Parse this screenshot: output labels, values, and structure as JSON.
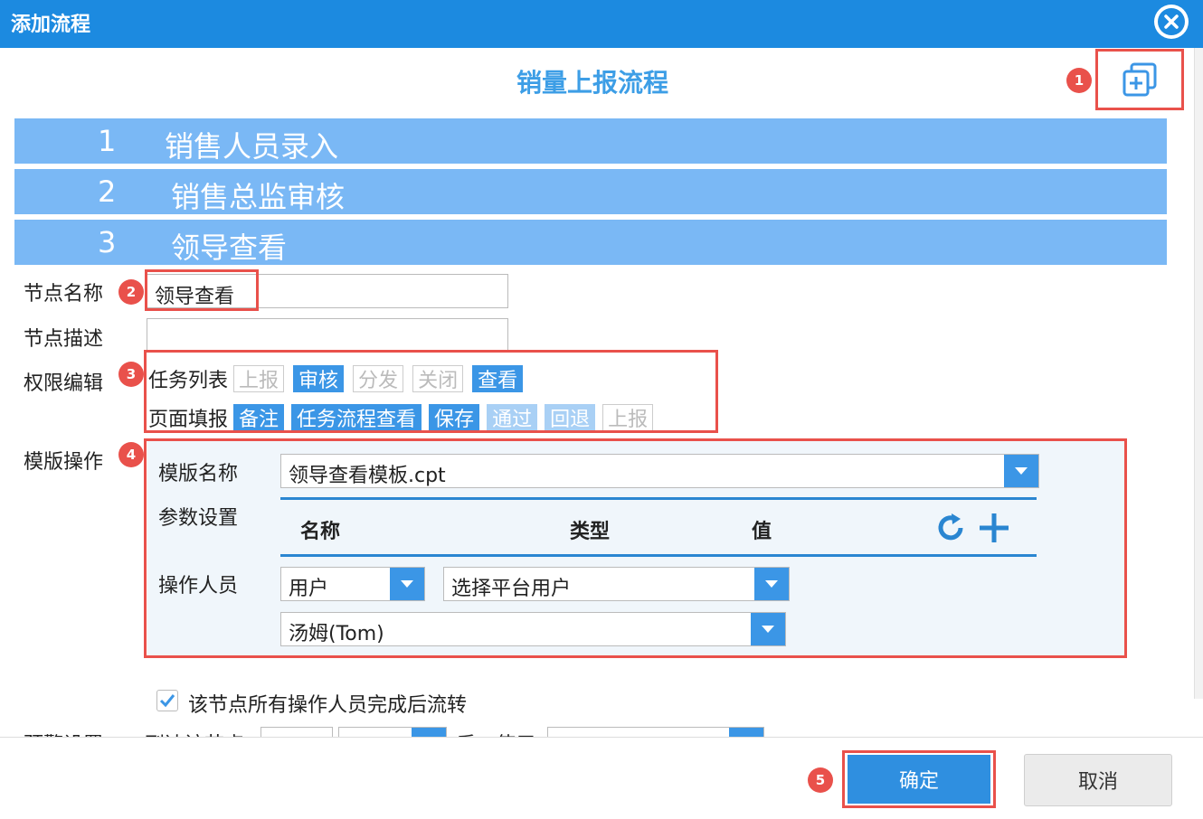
{
  "dialog": {
    "title": "添加流程"
  },
  "flow": {
    "title": "销量上报流程"
  },
  "steps": [
    {
      "num": "1",
      "name": "销售人员录入"
    },
    {
      "num": "2",
      "name": "销售总监审核"
    },
    {
      "num": "3",
      "name": "领导查看"
    }
  ],
  "badges": {
    "b1": "1",
    "b2": "2",
    "b3": "3",
    "b4": "4",
    "b5": "5"
  },
  "form": {
    "node_name_label": "节点名称",
    "node_name_value": "领导查看",
    "node_desc_label": "节点描述",
    "node_desc_value": "",
    "perm_label": "权限编辑",
    "tpl_op_label": "模版操作"
  },
  "permissions": {
    "task_list": {
      "label": "任务列表",
      "tags": [
        {
          "label": "上报",
          "state": "off"
        },
        {
          "label": "审核",
          "state": "on"
        },
        {
          "label": "分发",
          "state": "off"
        },
        {
          "label": "关闭",
          "state": "off"
        },
        {
          "label": "查看",
          "state": "on"
        }
      ]
    },
    "page_fill": {
      "label": "页面填报",
      "tags": [
        {
          "label": "备注",
          "state": "on"
        },
        {
          "label": "任务流程查看",
          "state": "on"
        },
        {
          "label": "保存",
          "state": "on"
        },
        {
          "label": "通过",
          "state": "light"
        },
        {
          "label": "回退",
          "state": "light"
        },
        {
          "label": "上报",
          "state": "off"
        }
      ]
    }
  },
  "template": {
    "name_label": "模版名称",
    "name_value": "领导查看模板.cpt",
    "param_label": "参数设置",
    "param_columns": [
      "名称",
      "类型",
      "值"
    ],
    "operator_label": "操作人员",
    "operator_type": "用户",
    "operator_source": "选择平台用户",
    "operator_user": "汤姆(Tom)"
  },
  "options": {
    "flow_after_all": "该节点所有操作人员完成后流转",
    "flow_after_all_checked": true
  },
  "cutoff_row": {
    "label": "预警设置",
    "text1": "到达该节点",
    "text2": "后，使用"
  },
  "buttons": {
    "ok": "确定",
    "cancel": "取消"
  },
  "colors": {
    "header": "#1c8ae0",
    "step_bar": "#7ab8f5",
    "accent": "#3b96e6",
    "highlight": "#e9514b",
    "panel_bg": "#f0f6fb"
  }
}
